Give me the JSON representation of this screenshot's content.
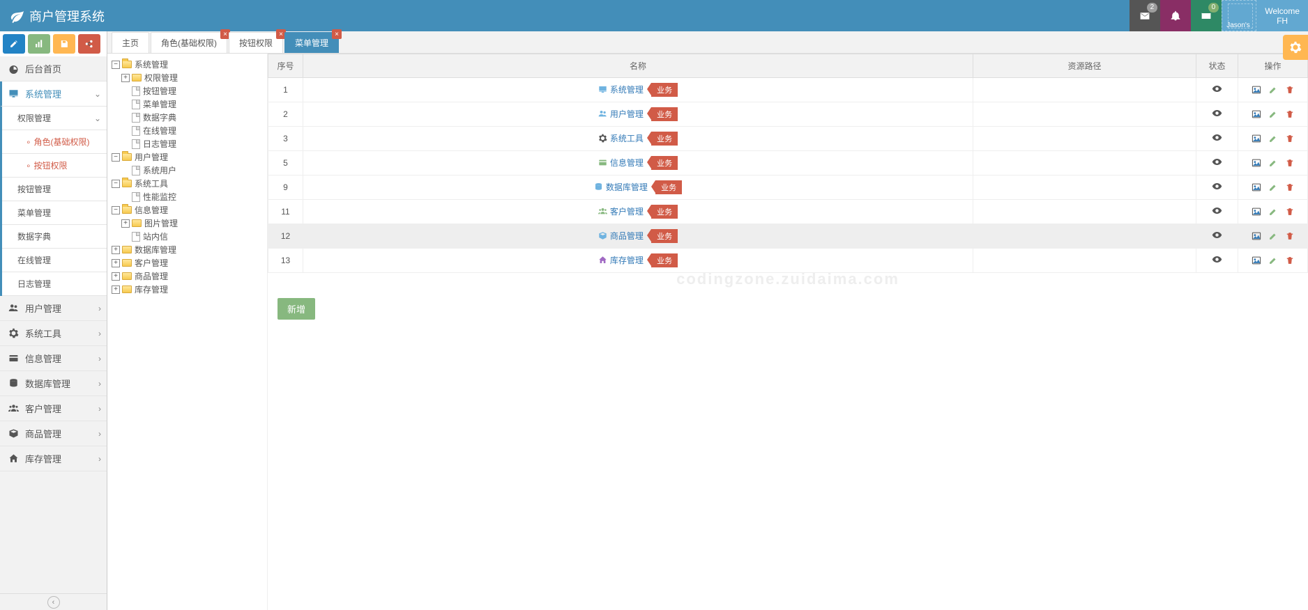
{
  "app": {
    "title": "商户管理系统",
    "welcome": "Welcome",
    "user": "FH",
    "avatar_label": "Jason's"
  },
  "nav_badges": {
    "mail": "2",
    "env": "0"
  },
  "toolbar": [
    "edit",
    "chart",
    "save",
    "share"
  ],
  "tabs": [
    {
      "label": "主页",
      "closable": false
    },
    {
      "label": "角色(基础权限)",
      "closable": true
    },
    {
      "label": "按钮权限",
      "closable": true
    },
    {
      "label": "菜单管理",
      "closable": true,
      "active": true
    }
  ],
  "sidebar": [
    {
      "icon": "dashboard",
      "label": "后台首页"
    },
    {
      "icon": "desktop",
      "label": "系统管理",
      "chev": "down",
      "open": true,
      "children": [
        {
          "label": "权限管理",
          "chev": "down",
          "children": [
            {
              "label": "角色(基础权限)",
              "active": true
            },
            {
              "label": "按钮权限",
              "active": true
            }
          ]
        },
        {
          "label": "按钮管理"
        },
        {
          "label": "菜单管理",
          "selected": true
        },
        {
          "label": "数据字典"
        },
        {
          "label": "在线管理"
        },
        {
          "label": "日志管理"
        }
      ]
    },
    {
      "icon": "users",
      "label": "用户管理",
      "chev": "right"
    },
    {
      "icon": "gear",
      "label": "系统工具",
      "chev": "right"
    },
    {
      "icon": "card",
      "label": "信息管理",
      "chev": "right"
    },
    {
      "icon": "db",
      "label": "数据库管理",
      "chev": "right"
    },
    {
      "icon": "users2",
      "label": "客户管理",
      "chev": "right"
    },
    {
      "icon": "box",
      "label": "商品管理",
      "chev": "right"
    },
    {
      "icon": "home",
      "label": "库存管理",
      "chev": "right"
    }
  ],
  "tree": [
    {
      "d": 0,
      "t": "minus",
      "f": "open",
      "label": "系统管理"
    },
    {
      "d": 1,
      "t": "plus",
      "f": "closed",
      "label": "权限管理"
    },
    {
      "d": 1,
      "t": "none",
      "leaf": true,
      "label": "按钮管理"
    },
    {
      "d": 1,
      "t": "none",
      "leaf": true,
      "label": "菜单管理"
    },
    {
      "d": 1,
      "t": "none",
      "leaf": true,
      "label": "数据字典"
    },
    {
      "d": 1,
      "t": "none",
      "leaf": true,
      "label": "在线管理"
    },
    {
      "d": 1,
      "t": "none",
      "leaf": true,
      "label": "日志管理"
    },
    {
      "d": 0,
      "t": "minus",
      "f": "open",
      "label": "用户管理"
    },
    {
      "d": 1,
      "t": "none",
      "leaf": true,
      "label": "系统用户"
    },
    {
      "d": 0,
      "t": "minus",
      "f": "open",
      "label": "系统工具"
    },
    {
      "d": 1,
      "t": "none",
      "leaf": true,
      "label": "性能监控"
    },
    {
      "d": 0,
      "t": "minus",
      "f": "open",
      "label": "信息管理"
    },
    {
      "d": 1,
      "t": "plus",
      "f": "closed",
      "label": "图片管理"
    },
    {
      "d": 1,
      "t": "none",
      "leaf": true,
      "label": "站内信"
    },
    {
      "d": 0,
      "t": "plus",
      "f": "closed",
      "label": "数据库管理"
    },
    {
      "d": 0,
      "t": "plus",
      "f": "closed",
      "label": "客户管理"
    },
    {
      "d": 0,
      "t": "plus",
      "f": "closed",
      "label": "商品管理"
    },
    {
      "d": 0,
      "t": "plus",
      "f": "closed",
      "label": "库存管理"
    }
  ],
  "table": {
    "headers": {
      "seq": "序号",
      "name": "名称",
      "path": "资源路径",
      "status": "状态",
      "op": "操作"
    },
    "tag": "业务",
    "rows": [
      {
        "seq": "1",
        "icon": "desktop",
        "color": "#6FB3E0",
        "name": "系统管理"
      },
      {
        "seq": "2",
        "icon": "users",
        "color": "#6FB3E0",
        "name": "用户管理"
      },
      {
        "seq": "3",
        "icon": "gear",
        "color": "#555",
        "name": "系统工具"
      },
      {
        "seq": "5",
        "icon": "card",
        "color": "#87B87F",
        "name": "信息管理"
      },
      {
        "seq": "9",
        "icon": "db",
        "color": "#6FB3E0",
        "name": "数据库管理"
      },
      {
        "seq": "11",
        "icon": "users2",
        "color": "#87B87F",
        "name": "客户管理"
      },
      {
        "seq": "12",
        "icon": "box",
        "color": "#6FB3E0",
        "name": "商品管理",
        "hover": true
      },
      {
        "seq": "13",
        "icon": "home",
        "color": "#A069C3",
        "name": "库存管理"
      }
    ]
  },
  "buttons": {
    "new": "新增"
  },
  "watermark": "codingzone.zuidaima.com"
}
